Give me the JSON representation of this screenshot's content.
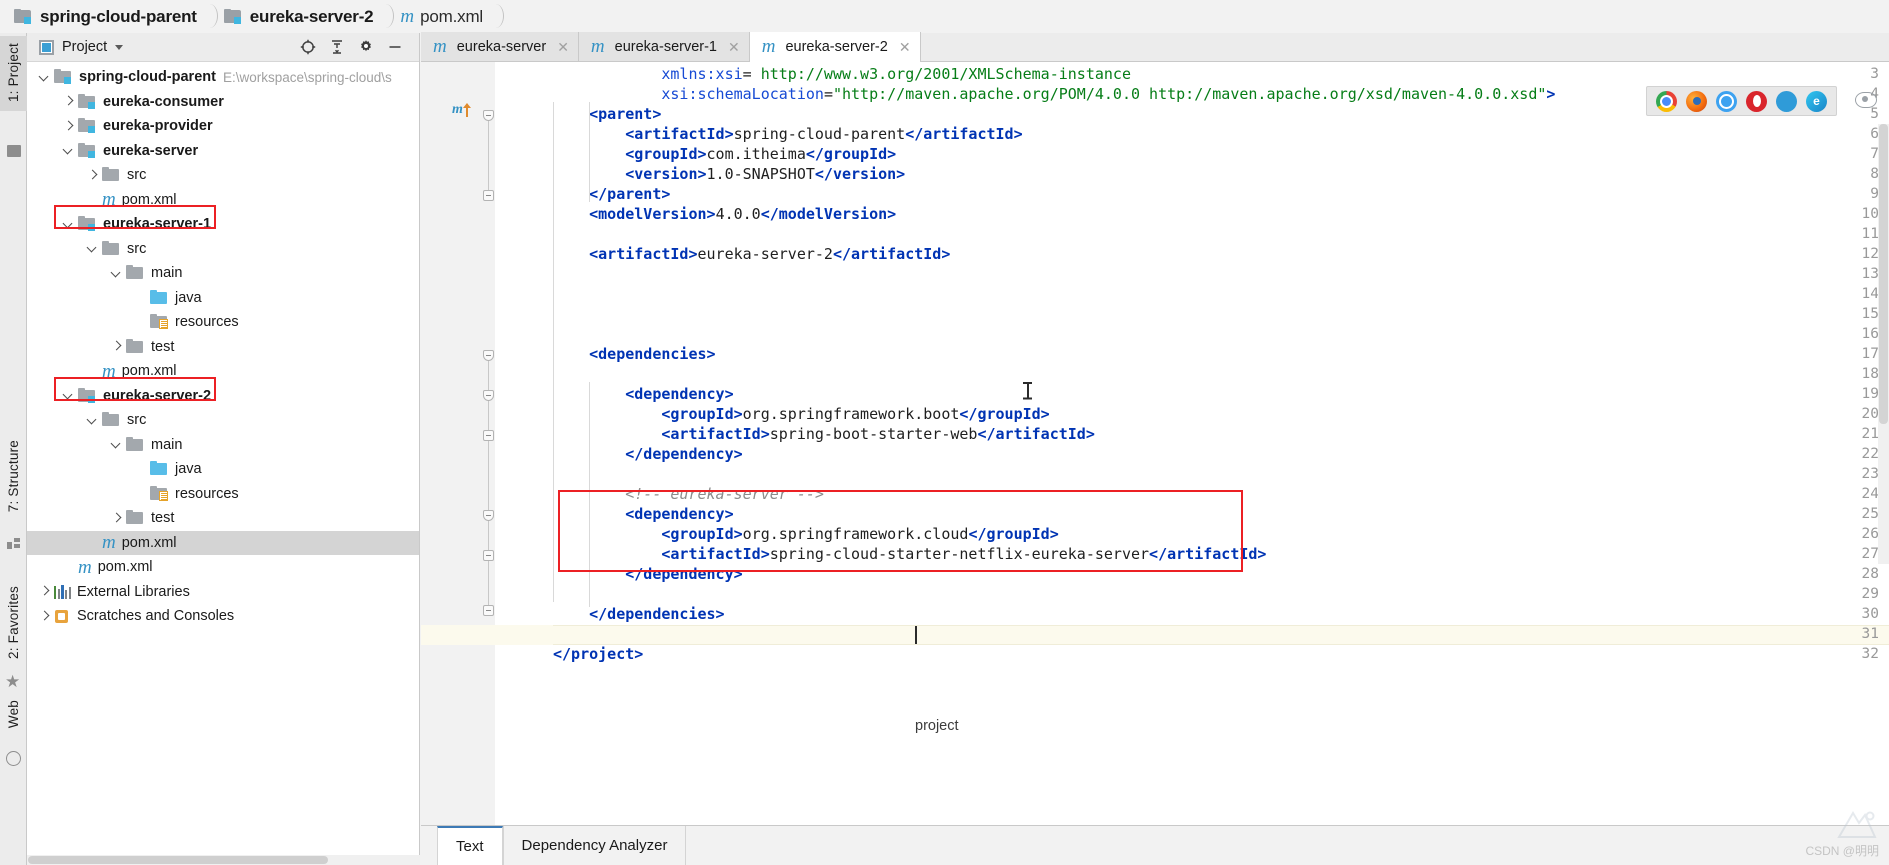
{
  "breadcrumb": {
    "items": [
      {
        "label": "spring-cloud-parent",
        "icon": "module-folder-icon"
      },
      {
        "label": "eureka-server-2",
        "icon": "module-folder-icon"
      },
      {
        "label": "pom.xml",
        "icon": "maven-m-icon"
      }
    ]
  },
  "left_strip": {
    "project_tab": "1: Project",
    "structure_tab": "7: Structure",
    "favorites_tab": "2: Favorites",
    "web_tab": "Web"
  },
  "project_panel": {
    "title": "Project",
    "header_icons": [
      "locate-icon",
      "collapse-all-icon",
      "settings-gear-icon",
      "hide-minus-icon"
    ],
    "tree": [
      {
        "id": "spring-cloud-parent",
        "label": "spring-cloud-parent",
        "path": "E:\\workspace\\spring-cloud\\s",
        "depth": 0,
        "chevron": "down",
        "icon": "module-folder-icon",
        "bold": true
      },
      {
        "id": "eureka-consumer",
        "label": "eureka-consumer",
        "path": "",
        "depth": 1,
        "chevron": "right",
        "icon": "module-folder-icon",
        "bold": true
      },
      {
        "id": "eureka-provider",
        "label": "eureka-provider",
        "path": "",
        "depth": 1,
        "chevron": "right",
        "icon": "module-folder-icon",
        "bold": true
      },
      {
        "id": "eureka-server",
        "label": "eureka-server",
        "path": "",
        "depth": 1,
        "chevron": "down",
        "icon": "module-folder-icon",
        "bold": true
      },
      {
        "id": "eureka-server-src",
        "label": "src",
        "path": "",
        "depth": 2,
        "chevron": "right",
        "icon": "folder-icon",
        "bold": false
      },
      {
        "id": "eureka-server-pom",
        "label": "pom.xml",
        "path": "",
        "depth": 2,
        "chevron": "none",
        "icon": "maven-m-icon",
        "bold": false
      },
      {
        "id": "eureka-server-1",
        "label": "eureka-server-1",
        "path": "",
        "depth": 1,
        "chevron": "down",
        "icon": "module-folder-icon",
        "bold": true,
        "highlight": true
      },
      {
        "id": "es1-src",
        "label": "src",
        "path": "",
        "depth": 2,
        "chevron": "down",
        "icon": "folder-icon",
        "bold": false
      },
      {
        "id": "es1-main",
        "label": "main",
        "path": "",
        "depth": 3,
        "chevron": "down",
        "icon": "folder-icon",
        "bold": false
      },
      {
        "id": "es1-java",
        "label": "java",
        "path": "",
        "depth": 4,
        "chevron": "none",
        "icon": "source-folder-icon",
        "bold": false
      },
      {
        "id": "es1-resources",
        "label": "resources",
        "path": "",
        "depth": 4,
        "chevron": "none",
        "icon": "resources-folder-icon",
        "bold": false
      },
      {
        "id": "es1-test",
        "label": "test",
        "path": "",
        "depth": 3,
        "chevron": "right",
        "icon": "folder-icon",
        "bold": false
      },
      {
        "id": "es1-pom",
        "label": "pom.xml",
        "path": "",
        "depth": 2,
        "chevron": "none",
        "icon": "maven-m-icon",
        "bold": false
      },
      {
        "id": "eureka-server-2",
        "label": "eureka-server-2",
        "path": "",
        "depth": 1,
        "chevron": "down",
        "icon": "module-folder-icon",
        "bold": true,
        "highlight": true
      },
      {
        "id": "es2-src",
        "label": "src",
        "path": "",
        "depth": 2,
        "chevron": "down",
        "icon": "folder-icon",
        "bold": false
      },
      {
        "id": "es2-main",
        "label": "main",
        "path": "",
        "depth": 3,
        "chevron": "down",
        "icon": "folder-icon",
        "bold": false
      },
      {
        "id": "es2-java",
        "label": "java",
        "path": "",
        "depth": 4,
        "chevron": "none",
        "icon": "source-folder-icon",
        "bold": false
      },
      {
        "id": "es2-resources",
        "label": "resources",
        "path": "",
        "depth": 4,
        "chevron": "none",
        "icon": "resources-folder-icon",
        "bold": false
      },
      {
        "id": "es2-test",
        "label": "test",
        "path": "",
        "depth": 3,
        "chevron": "right",
        "icon": "folder-icon",
        "bold": false
      },
      {
        "id": "es2-pom",
        "label": "pom.xml",
        "path": "",
        "depth": 2,
        "chevron": "none",
        "icon": "maven-m-icon",
        "bold": false,
        "selected": true
      },
      {
        "id": "root-pom",
        "label": "pom.xml",
        "path": "",
        "depth": 1,
        "chevron": "none",
        "icon": "maven-m-icon",
        "bold": false
      },
      {
        "id": "external-libraries",
        "label": "External Libraries",
        "path": "",
        "depth": 0,
        "chevron": "right",
        "icon": "libraries-icon",
        "bold": false
      },
      {
        "id": "scratches-and-consoles",
        "label": "Scratches and Consoles",
        "path": "",
        "depth": 0,
        "chevron": "right",
        "icon": "scratches-icon",
        "bold": false
      }
    ]
  },
  "editor": {
    "tabs": [
      {
        "label": "eureka-server",
        "icon": "maven-m-icon",
        "active": false
      },
      {
        "label": "eureka-server-1",
        "icon": "maven-m-icon",
        "active": false
      },
      {
        "label": "eureka-server-2",
        "icon": "maven-m-icon",
        "active": true
      }
    ],
    "first_visible_line": 3,
    "caret_line": 31,
    "breadcrumb_status": "project",
    "lines": [
      {
        "n": 3,
        "indent": 0,
        "html": "            <span class=\"attr\">xmlns:xsi</span><span class=\"txt\">=</span> <span class=\"str\">http://www.w3.org/2001/XMLSchema-instance</span>"
      },
      {
        "n": 4,
        "indent": 0,
        "html": "            <span class=\"attr\">xsi:schemaLocation</span><span class=\"txt\">=</span><span class=\"str\">\"http://maven.apache.org/POM/4.0.0 http://maven.apache.org/xsd/maven-4.0.0.xsd\"</span><span class=\"tag\">></span>"
      },
      {
        "n": 5,
        "indent": 0,
        "html": "    <span class=\"tag\">&lt;parent&gt;</span>"
      },
      {
        "n": 6,
        "indent": 0,
        "html": "        <span class=\"tag\">&lt;artifactId&gt;</span><span class=\"txt\">spring-cloud-parent</span><span class=\"tag\">&lt;/artifactId&gt;</span>"
      },
      {
        "n": 7,
        "indent": 0,
        "html": "        <span class=\"tag\">&lt;groupId&gt;</span><span class=\"txt\">com.itheima</span><span class=\"tag\">&lt;/groupId&gt;</span>"
      },
      {
        "n": 8,
        "indent": 0,
        "html": "        <span class=\"tag\">&lt;version&gt;</span><span class=\"txt\">1.0-SNAPSHOT</span><span class=\"tag\">&lt;/version&gt;</span>"
      },
      {
        "n": 9,
        "indent": 0,
        "html": "    <span class=\"tag\">&lt;/parent&gt;</span>"
      },
      {
        "n": 10,
        "indent": 0,
        "html": "    <span class=\"tag\">&lt;modelVersion&gt;</span><span class=\"txt\">4.0.0</span><span class=\"tag\">&lt;/modelVersion&gt;</span>"
      },
      {
        "n": 11,
        "indent": 0,
        "html": ""
      },
      {
        "n": 12,
        "indent": 0,
        "html": "    <span class=\"tag\">&lt;artifactId&gt;</span><span class=\"txt\">eureka-server-2</span><span class=\"tag\">&lt;/artifactId&gt;</span>"
      },
      {
        "n": 13,
        "indent": 0,
        "html": ""
      },
      {
        "n": 14,
        "indent": 0,
        "html": ""
      },
      {
        "n": 15,
        "indent": 0,
        "html": ""
      },
      {
        "n": 16,
        "indent": 0,
        "html": ""
      },
      {
        "n": 17,
        "indent": 0,
        "html": "    <span class=\"tag\">&lt;dependencies&gt;</span>"
      },
      {
        "n": 18,
        "indent": 0,
        "html": ""
      },
      {
        "n": 19,
        "indent": 0,
        "html": "        <span class=\"tag\">&lt;dependency&gt;</span>"
      },
      {
        "n": 20,
        "indent": 0,
        "html": "            <span class=\"tag\">&lt;groupId&gt;</span><span class=\"txt\">org.springframework.boot</span><span class=\"tag\">&lt;/groupId&gt;</span>"
      },
      {
        "n": 21,
        "indent": 0,
        "html": "            <span class=\"tag\">&lt;artifactId&gt;</span><span class=\"txt\">spring-boot-starter-web</span><span class=\"tag\">&lt;/artifactId&gt;</span>"
      },
      {
        "n": 22,
        "indent": 0,
        "html": "        <span class=\"tag\">&lt;/dependency&gt;</span>"
      },
      {
        "n": 23,
        "indent": 0,
        "html": ""
      },
      {
        "n": 24,
        "indent": 0,
        "html": "        <span class=\"cmt\">&lt;!-- eureka-server --&gt;</span>"
      },
      {
        "n": 25,
        "indent": 0,
        "html": "        <span class=\"tag\">&lt;dependency&gt;</span>"
      },
      {
        "n": 26,
        "indent": 0,
        "html": "            <span class=\"tag\">&lt;groupId&gt;</span><span class=\"txt\">org.springframework.cloud</span><span class=\"tag\">&lt;/groupId&gt;</span>"
      },
      {
        "n": 27,
        "indent": 0,
        "html": "            <span class=\"tag\">&lt;artifactId&gt;</span><span class=\"txt\">spring-cloud-starter-netflix-eureka-server</span><span class=\"tag\">&lt;/artifactId&gt;</span>"
      },
      {
        "n": 28,
        "indent": 0,
        "html": "        <span class=\"tag\">&lt;/dependency&gt;</span>"
      },
      {
        "n": 29,
        "indent": 0,
        "html": ""
      },
      {
        "n": 30,
        "indent": 0,
        "html": "    <span class=\"tag\">&lt;/dependencies&gt;</span>"
      },
      {
        "n": 31,
        "indent": 0,
        "html": ""
      },
      {
        "n": 32,
        "indent": 0,
        "html": "<span class=\"tag\">&lt;/project&gt;</span>"
      }
    ]
  },
  "browser_tray": {
    "icons": [
      "chrome-icon",
      "firefox-icon",
      "safari-icon",
      "opera-icon",
      "ie-icon",
      "edge-icon"
    ]
  },
  "bottom_tabs": [
    {
      "label": "Text",
      "active": true
    },
    {
      "label": "Dependency Analyzer",
      "active": false
    }
  ],
  "watermark": "CSDN @明明",
  "colors": {
    "accent_blue": "#3592c4",
    "highlight_red": "#ec2024",
    "tag_blue": "#0033b3",
    "string_green": "#067d17",
    "comment_gray": "#8c8c8c",
    "selection_gray": "#d4d4d4",
    "caret_line": "#fcfaed"
  }
}
